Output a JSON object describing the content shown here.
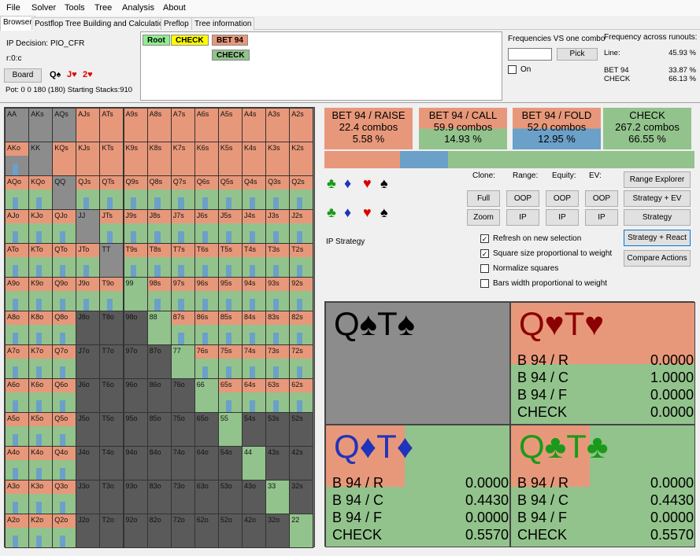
{
  "menu": [
    "File",
    "Solver",
    "Tools",
    "Tree",
    "Analysis",
    "About"
  ],
  "tabs": [
    "Browser",
    "Postflop Tree Building and Calculations",
    "Preflop",
    "Tree information"
  ],
  "info": {
    "decision": "IP Decision:  PIO_CFR",
    "node": "r:0:c",
    "board_btn": "Board",
    "board_cards": [
      "Q♠",
      "J♥",
      "2♥"
    ],
    "pot": "Pot: 0 0 180 (180) Starting Stacks:910"
  },
  "tree": {
    "root": "Root",
    "check": "CHECK",
    "bet": "BET 94",
    "check2": "CHECK"
  },
  "freq": {
    "vs_combo": "Frequencies VS one combo",
    "pick": "Pick",
    "on": "On",
    "across": "Frequency across runouts:",
    "line_label": "Line:",
    "line_val": "45.93 %",
    "bet_label": "BET 94",
    "bet_val": "33.87 %",
    "check_label": "CHECK",
    "check_val": "66.13 %"
  },
  "summary": [
    {
      "title": "BET 94 / RAISE",
      "combos": "22.4 combos",
      "pct": "5.58 %",
      "color": "#e8987a",
      "share": 0.0558
    },
    {
      "title": "BET 94 / CALL",
      "combos": "59.9 combos",
      "pct": "14.93 %",
      "color": "#92c38c",
      "share": 0.1493
    },
    {
      "title": "BET 94 / FOLD",
      "combos": "52.0 combos",
      "pct": "12.95 %",
      "color": "#6ba0c8",
      "share": 0.1295
    },
    {
      "title": "CHECK",
      "combos": "267.2 combos",
      "pct": "66.55 %",
      "color": "#92c38c",
      "share": 0.6655
    }
  ],
  "controls": {
    "clone": "Clone:",
    "range": "Range:",
    "equity": "Equity:",
    "ev": "EV:",
    "full": "Full",
    "zoom": "Zoom",
    "oop": "OOP",
    "ip": "IP",
    "range_explorer": "Range Explorer",
    "strategy_ev": "Strategy + EV",
    "strategy": "Strategy",
    "strategy_react": "Strategy + React",
    "compare": "Compare Actions",
    "ip_strategy": "IP Strategy"
  },
  "checks": [
    {
      "label": "Refresh on new selection",
      "checked": true
    },
    {
      "label": "Square size proportional to weight",
      "checked": true
    },
    {
      "label": "Normalize squares",
      "checked": false
    },
    {
      "label": "Bars width proportional to weight",
      "checked": false
    }
  ],
  "combos": [
    {
      "name": "Q♠T♠",
      "color": "#000",
      "bg": "gray",
      "rows": []
    },
    {
      "name": "Q♥T♥",
      "color": "#8b0000",
      "bg": "mixed1",
      "rows": [
        [
          "B 94 / R",
          "0.0000"
        ],
        [
          "B 94 / C",
          "1.0000"
        ],
        [
          "B 94 / F",
          "0.0000"
        ],
        [
          "CHECK",
          "0.0000"
        ]
      ]
    },
    {
      "name": "Q♦T♦",
      "color": "#2233bb",
      "bg": "mixed2",
      "rows": [
        [
          "B 94 / R",
          "0.0000"
        ],
        [
          "B 94 / C",
          "0.4430"
        ],
        [
          "B 94 / F",
          "0.0000"
        ],
        [
          "CHECK",
          "0.5570"
        ]
      ]
    },
    {
      "name": "Q♣T♣",
      "color": "#1a9a1a",
      "bg": "mixed2",
      "rows": [
        [
          "B 94 / R",
          "0.0000"
        ],
        [
          "B 94 / C",
          "0.4430"
        ],
        [
          "B 94 / F",
          "0.0000"
        ],
        [
          "CHECK",
          "0.5570"
        ]
      ]
    }
  ],
  "ranks": [
    "A",
    "K",
    "Q",
    "J",
    "T",
    "9",
    "8",
    "7",
    "6",
    "5",
    "4",
    "3",
    "2"
  ],
  "colors": {
    "raise": "#e8987a",
    "call": "#92c38c",
    "fold": "#6ba0c8",
    "check": "#92c38c",
    "empty": "#5a5a5a",
    "dead": "#8c8c8c"
  }
}
